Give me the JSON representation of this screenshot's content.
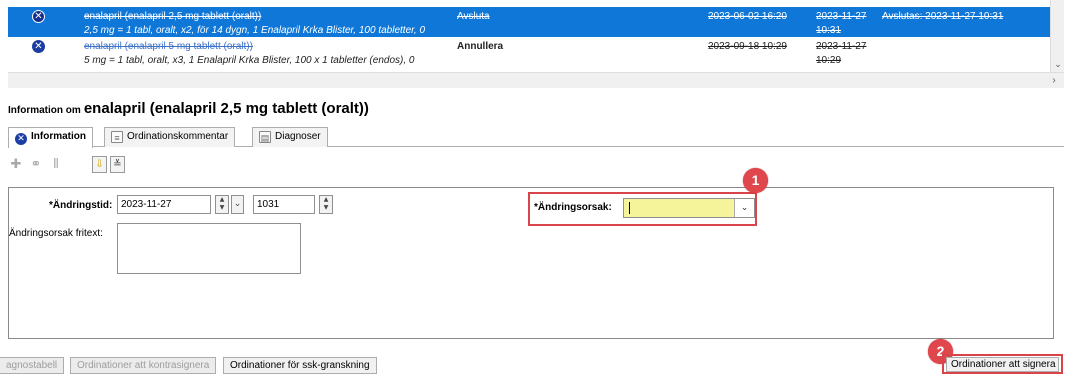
{
  "rows": [
    {
      "name": "enalapril (enalapril 2,5 mg tablett (oralt))",
      "detail": "2,5 mg = 1 tabl, oralt, x2, för 14 dygn, 1 Enalapril Krka Blister, 100 tabletter, 0",
      "action": "Avsluta",
      "start": "2023-06-02 16:20",
      "end_date": "2023-11-27",
      "end_time": "10:31",
      "note": "Avslutas: 2023-11-27 10:31"
    },
    {
      "name": "enalapril (enalapril 5 mg tablett (oralt))",
      "detail": "5 mg = 1 tabl, oralt, x3, 1 Enalapril Krka Blister, 100 x 1 tabletter (endos), 0",
      "action": "Annullera",
      "start": "2023-09-18 10:29",
      "end_date": "2023-11-27",
      "end_time": "10:29",
      "note": ""
    }
  ],
  "info": {
    "prefix": "Information om",
    "drug": "enalapril (enalapril 2,5 mg tablett (oralt))"
  },
  "tabs": [
    {
      "label": "Information"
    },
    {
      "label": "Ordinationskommentar"
    },
    {
      "label": "Diagnoser"
    }
  ],
  "form": {
    "andringstid_label": "*Ändringstid:",
    "date_value": "2023-11-27",
    "time_value": "1031",
    "fritext_label": "Ändringsorsak fritext:",
    "orsak_label": "*Ändringsorsak:",
    "orsak_value": ""
  },
  "badges": {
    "one": "1",
    "two": "2"
  },
  "bottom_buttons": [
    {
      "label": "agnostabell"
    },
    {
      "label": "Ordinationer att kontrasignera"
    },
    {
      "label": "Ordinationer för ssk-granskning"
    },
    {
      "label": "Ordinationer att signera"
    }
  ],
  "colors": {
    "selection": "#0f77d8",
    "highlight_red": "#d9434a",
    "required_field": "#f6f49a"
  },
  "icons": [
    "cancel-x-icon",
    "add-icon",
    "hierarchy-icon",
    "chart-icon",
    "arrow-down-icon",
    "double-chevron-down-icon",
    "document-icon"
  ]
}
